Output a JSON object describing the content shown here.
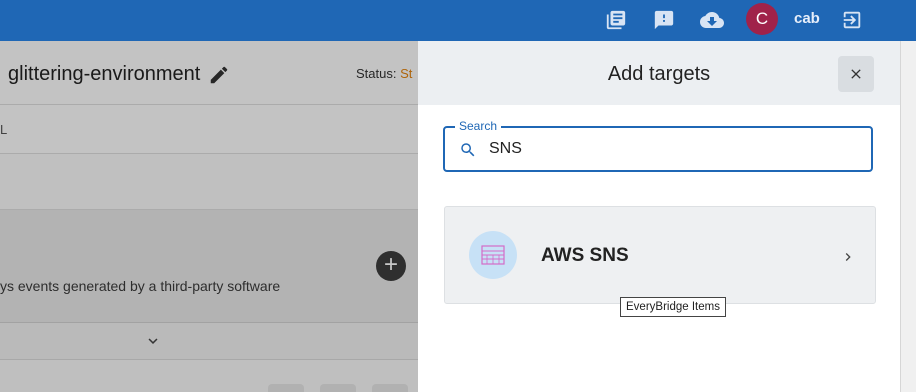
{
  "topbar": {
    "icons": [
      "library-books-icon",
      "feedback-icon",
      "cloud-download-icon",
      "logout-icon"
    ],
    "avatar_initial": "C",
    "username": "cab",
    "accent_color": "#1f67b5",
    "avatar_color": "#a0224a"
  },
  "background_page": {
    "title": "glittering-environment",
    "status_label": "Status:",
    "status_value": "St",
    "row_label": "L",
    "description": "ys events generated by a third-party software"
  },
  "drawer": {
    "title": "Add targets",
    "search": {
      "label": "Search",
      "value": "SNS"
    },
    "results": [
      {
        "title": "AWS SNS",
        "icon": "aws-sns-icon"
      }
    ]
  },
  "tooltip": {
    "text": "EveryBridge Items"
  }
}
